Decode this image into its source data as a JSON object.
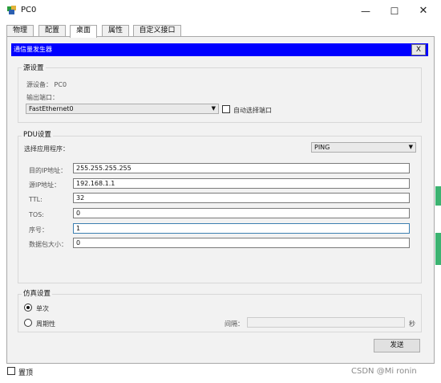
{
  "window": {
    "title": "PC0",
    "minimize": "—",
    "maximize": "☐",
    "close": "✕"
  },
  "tabs": [
    "物理",
    "配置",
    "桌面",
    "属性",
    "自定义接口"
  ],
  "active_tab": "桌面",
  "dialog": {
    "title": "通信量发生器",
    "close_label": "X",
    "source": {
      "group_label": "源设置",
      "device_line": "源设备：  PC0",
      "port_label": "输出端口：",
      "port_value": "FastEthernet0",
      "auto_label": "自动选择端口"
    },
    "pdu": {
      "group_label": "PDU设置",
      "app_label": "选择应用程序：",
      "app_value": "PING",
      "fields": [
        {
          "label": "目的IP地址：",
          "value": "255.255.255.255"
        },
        {
          "label": "源IP地址：",
          "value": "192.168.1.1"
        },
        {
          "label": "TTL:",
          "value": "32"
        },
        {
          "label": "TOS:",
          "value": "0"
        },
        {
          "label": "序号：",
          "value": "1"
        },
        {
          "label": "数据包大小：",
          "value": "0"
        }
      ]
    },
    "sim": {
      "group_label": "仿真设置",
      "single_label": "单次",
      "periodic_label": "周期性",
      "interval_label": "间隔：",
      "interval_value": "",
      "unit": "秒",
      "selected": "单次"
    },
    "send_label": "发送"
  },
  "footer": {
    "pin_label": "置顶"
  },
  "watermark": "CSDN @Mi ronin",
  "colors": {
    "dialog_title_bg": "#0000ff",
    "side_accent": "#3cb371"
  }
}
